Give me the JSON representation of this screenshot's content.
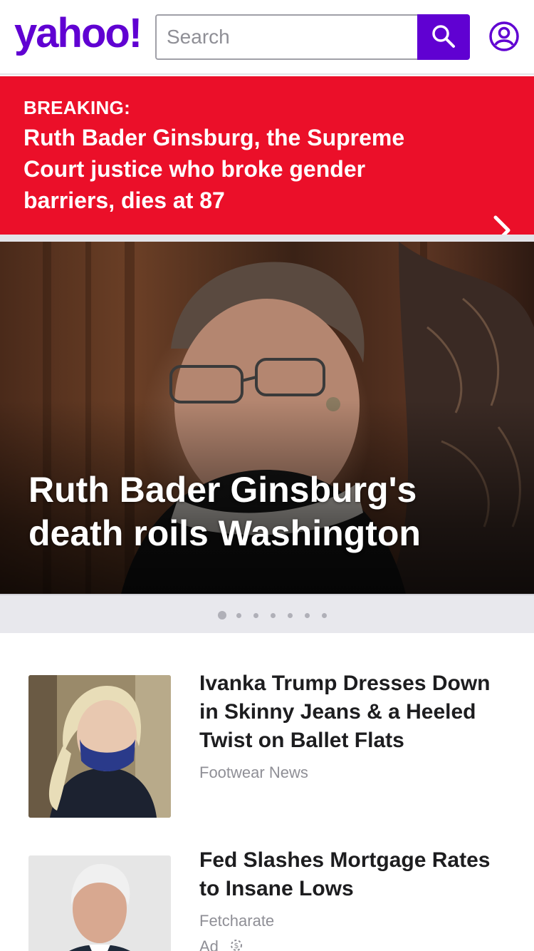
{
  "header": {
    "logo": "yahoo!",
    "search_placeholder": "Search"
  },
  "breaking": {
    "label": "BREAKING:",
    "headline": "Ruth Bader Ginsburg, the Supreme Court justice who broke gender barriers, dies at 87"
  },
  "hero": {
    "title": "Ruth Bader Ginsburg's death roils Washington",
    "slide_count": 7,
    "active_slide": 1
  },
  "stream": [
    {
      "title": "Ivanka Trump Dresses Down in Skinny Jeans & a Heeled Twist on Ballet Flats",
      "source": "Footwear News"
    },
    {
      "title": "Fed Slashes Mortgage Rates to Insane Lows",
      "source": "Fetcharate",
      "ad_label": "Ad"
    }
  ],
  "colors": {
    "brand": "#6001d2",
    "breaking": "#eb0f29"
  },
  "icons": {
    "search": "search-icon",
    "account": "account-icon",
    "breaking_arrow": "chevron-right-icon",
    "ad_choices": "ad-choices-icon"
  }
}
